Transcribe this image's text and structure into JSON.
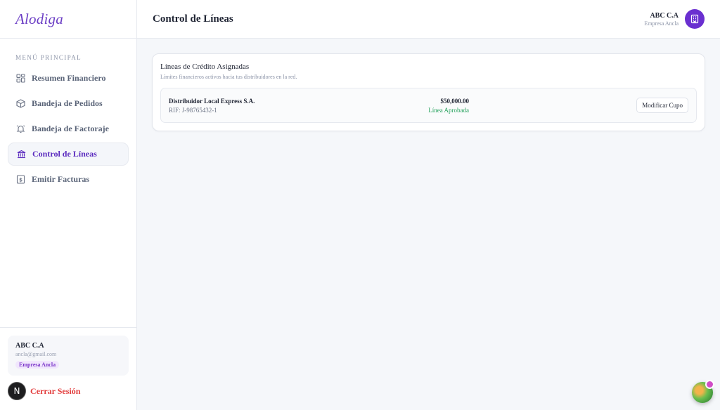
{
  "brand": {
    "name": "Alodiga"
  },
  "sidebar": {
    "section_title": "MENÚ PRINCIPAL",
    "items": [
      {
        "label": "Resumen Financiero",
        "icon": "dashboard-grid-icon",
        "active": false
      },
      {
        "label": "Bandeja de Pedidos",
        "icon": "package-box-icon",
        "active": false
      },
      {
        "label": "Bandeja de Factoraje",
        "icon": "bell-icon",
        "active": false
      },
      {
        "label": "Control de Líneas",
        "icon": "bank-icon",
        "active": true
      },
      {
        "label": "Emitir Facturas",
        "icon": "invoice-dollar-icon",
        "active": false
      }
    ],
    "user": {
      "name": "ABC C.A",
      "email": "ancla@gmail.com",
      "role_badge": "Empresa Ancla"
    },
    "logout": {
      "avatar_letter": "N",
      "label": "Cerrar Sesión"
    }
  },
  "header": {
    "title": "Control de Líneas",
    "company_name": "ABC C.A",
    "company_role": "Empresa Ancla",
    "company_icon": "building-icon"
  },
  "card": {
    "title": "Líneas de Crédito Asignadas",
    "subtitle": "Límites financieros activos hacia tus distribuidores en la red.",
    "lines": [
      {
        "distributor": "Distribuidor Local Express S.A.",
        "rif": "RIF: J-98765432-1",
        "amount": "$50,000.00",
        "status": "Línea Aprobada",
        "action_label": "Modificar Cupo"
      }
    ]
  },
  "colors": {
    "accent": "#6c3fc5",
    "active_nav": "#5b2bbf",
    "approved": "#22a05a",
    "danger": "#e23b3b"
  }
}
